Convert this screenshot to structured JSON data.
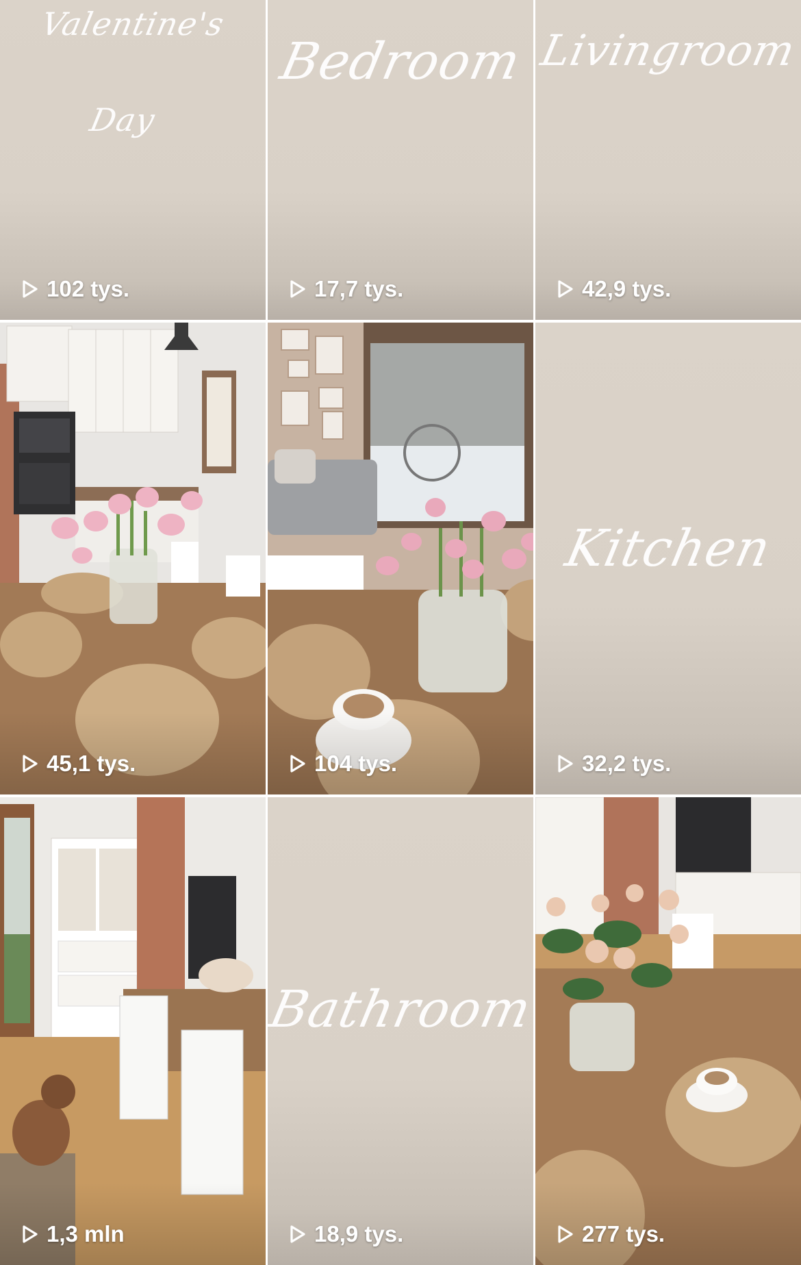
{
  "tiles": [
    {
      "kind": "title",
      "title_lines": [
        "Valentine's",
        "Day"
      ],
      "views": "102 tys."
    },
    {
      "kind": "title",
      "title_lines": [
        "Bedroom"
      ],
      "views": "17,7 tys."
    },
    {
      "kind": "title",
      "title_lines": [
        "Livingroom"
      ],
      "views": "42,9 tys."
    },
    {
      "kind": "photo",
      "scene": "kitchen-tulips",
      "views": "45,1 tys."
    },
    {
      "kind": "photo",
      "scene": "tulips-coffee-window",
      "views": "104 tys."
    },
    {
      "kind": "title",
      "title_lines": [
        "Kitchen"
      ],
      "views": "32,2 tys."
    },
    {
      "kind": "photo",
      "scene": "dining-room-dog",
      "views": "1,3 mln"
    },
    {
      "kind": "title",
      "title_lines": [
        "Bathroom"
      ],
      "views": "18,9 tys."
    },
    {
      "kind": "photo",
      "scene": "roses-table",
      "views": "277 tys."
    }
  ],
  "colors": {
    "cover_beige": "#d9d1c7",
    "text_white": "#ffffff"
  },
  "icons": {
    "view_icon": "play-icon"
  }
}
